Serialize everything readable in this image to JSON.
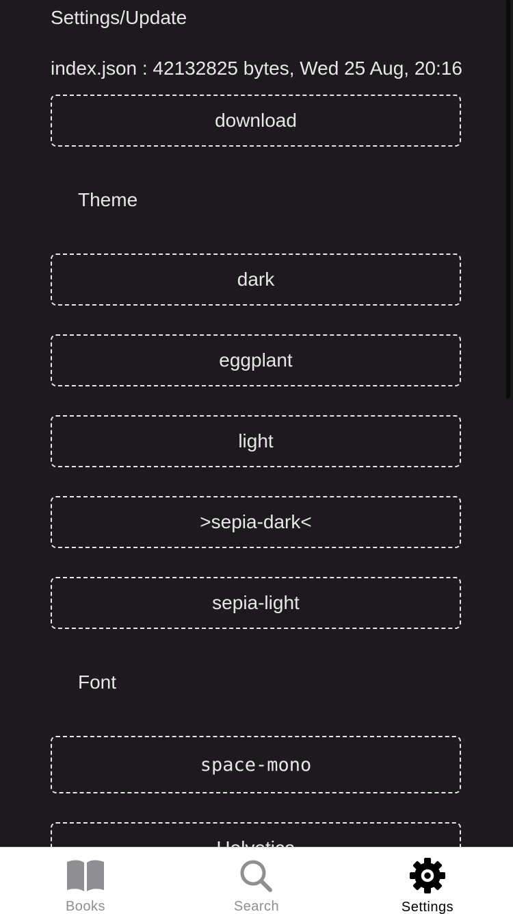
{
  "page": {
    "title": "Settings/Update",
    "file_info": "index.json : 42132825 bytes,  Wed 25 Aug, 20:16"
  },
  "update": {
    "download_label": "download"
  },
  "theme": {
    "label": "Theme",
    "options": [
      "dark",
      "eggplant",
      "light",
      ">sepia-dark<",
      "sepia-light"
    ],
    "selected": "sepia-dark"
  },
  "font": {
    "label": "Font",
    "options": [
      "space-mono",
      "Helvetica"
    ]
  },
  "tabbar": {
    "tabs": [
      {
        "label": "Books",
        "icon": "book-icon",
        "active": false
      },
      {
        "label": "Search",
        "icon": "search-icon",
        "active": false
      },
      {
        "label": "Settings",
        "icon": "gear-icon",
        "active": true
      }
    ]
  },
  "colors": {
    "background": "#1c1a1c",
    "text": "#e8e6e8",
    "tabbar_bg": "#ffffff",
    "tab_inactive": "#8e8e93",
    "tab_active": "#000000"
  }
}
